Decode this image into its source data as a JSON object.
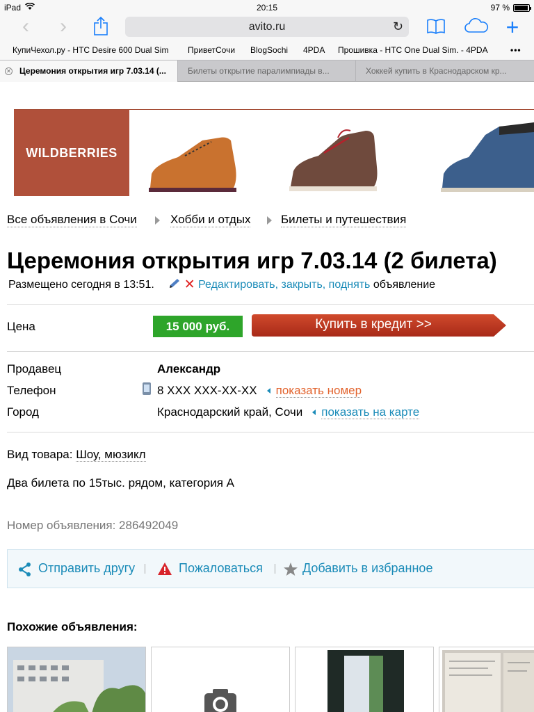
{
  "status_bar": {
    "device": "iPad",
    "time": "20:15",
    "battery": "97 %",
    "battery_level": 0.97
  },
  "browser": {
    "url": "avito.ru",
    "bookmarks": [
      "КупиЧехол.ру - HTC Desire 600 Dual Sim",
      "ПриветСочи",
      "BlogSochi",
      "4PDA",
      "Прошивка - HTC One Dual Sim. - 4PDA",
      "•••"
    ],
    "tabs": [
      {
        "label": "Церемония открытия игр 7.03.14 (..."
      },
      {
        "label": "Билеты открытие паралимпиады в..."
      },
      {
        "label": "Хоккей купить в Краснодарском кр..."
      }
    ]
  },
  "banner": {
    "brand": "WILDBERRIES"
  },
  "breadcrumbs": [
    "Все объявления в Сочи",
    "Хобби и отдых",
    "Билеты и путешествия"
  ],
  "listing": {
    "title": "Церемония открытия игр 7.03.14 (2 билета)",
    "posted": "Размещено сегодня в 13:51.",
    "edit_link": "Редактировать, закрыть, поднять",
    "edit_suffix": "объявление",
    "price_label": "Цена",
    "price": "15 000 руб.",
    "credit_button": "Купить в кредит >>",
    "seller_label": "Продавец",
    "seller": "Александр",
    "phone_label": "Телефон",
    "phone": "8 XXX XXX-XX-XX",
    "show_phone": "показать номер",
    "city_label": "Город",
    "city": "Краснодарский край, Сочи",
    "show_map": "показать на карте",
    "type_label": "Вид товара:",
    "type_value": "Шоу, мюзикл",
    "description": "Два билета по 15тыс. рядом, категория А",
    "listing_number": "Номер объявления: 286492049"
  },
  "actions": {
    "send": "Отправить другу",
    "report": "Пожаловаться",
    "favorite": "Добавить в избранное"
  },
  "similar": {
    "title": "Похожие объявления:"
  },
  "colors": {
    "accent": "#1a8bb8",
    "price_green": "#2ea52a",
    "credit_red": "#b8321c",
    "orange_link": "#e2642e",
    "ios_blue": "#1a7ffb"
  }
}
